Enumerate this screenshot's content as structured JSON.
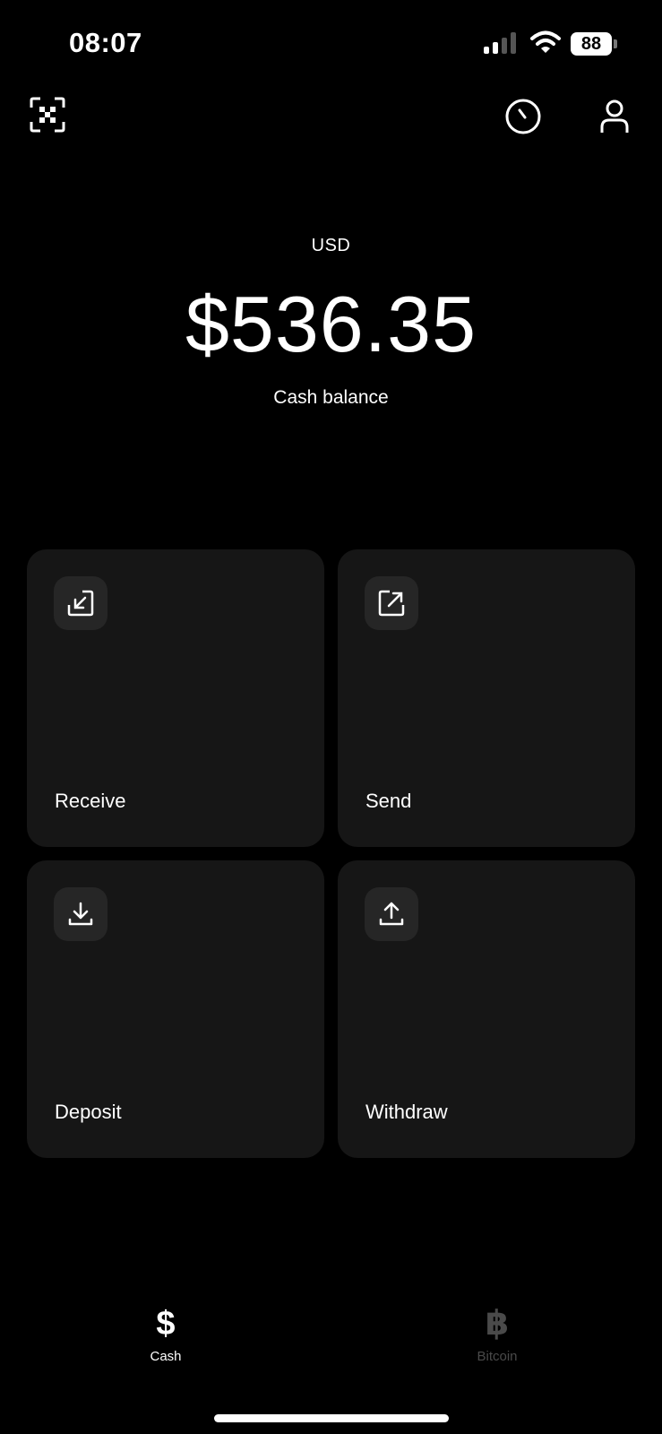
{
  "status_bar": {
    "time": "08:07",
    "battery": "88"
  },
  "header": {
    "left_icon": "qr-scan-icon",
    "right_icons": [
      "clock-icon",
      "profile-icon"
    ]
  },
  "balance": {
    "currency": "USD",
    "amount": "$536.35",
    "label": "Cash balance"
  },
  "actions": [
    {
      "label": "Receive",
      "icon": "arrow-down-left-icon"
    },
    {
      "label": "Send",
      "icon": "arrow-up-right-icon"
    },
    {
      "label": "Deposit",
      "icon": "download-icon"
    },
    {
      "label": "Withdraw",
      "icon": "upload-icon"
    }
  ],
  "bottom_nav": [
    {
      "glyph": "$",
      "label": "Cash",
      "active": true
    },
    {
      "glyph": "฿",
      "label": "Bitcoin",
      "active": false
    }
  ],
  "colors": {
    "background": "#000000",
    "tile": "#161616",
    "tile_icon_bg": "#262626",
    "text": "#ffffff",
    "inactive": "#4a4a4a"
  }
}
